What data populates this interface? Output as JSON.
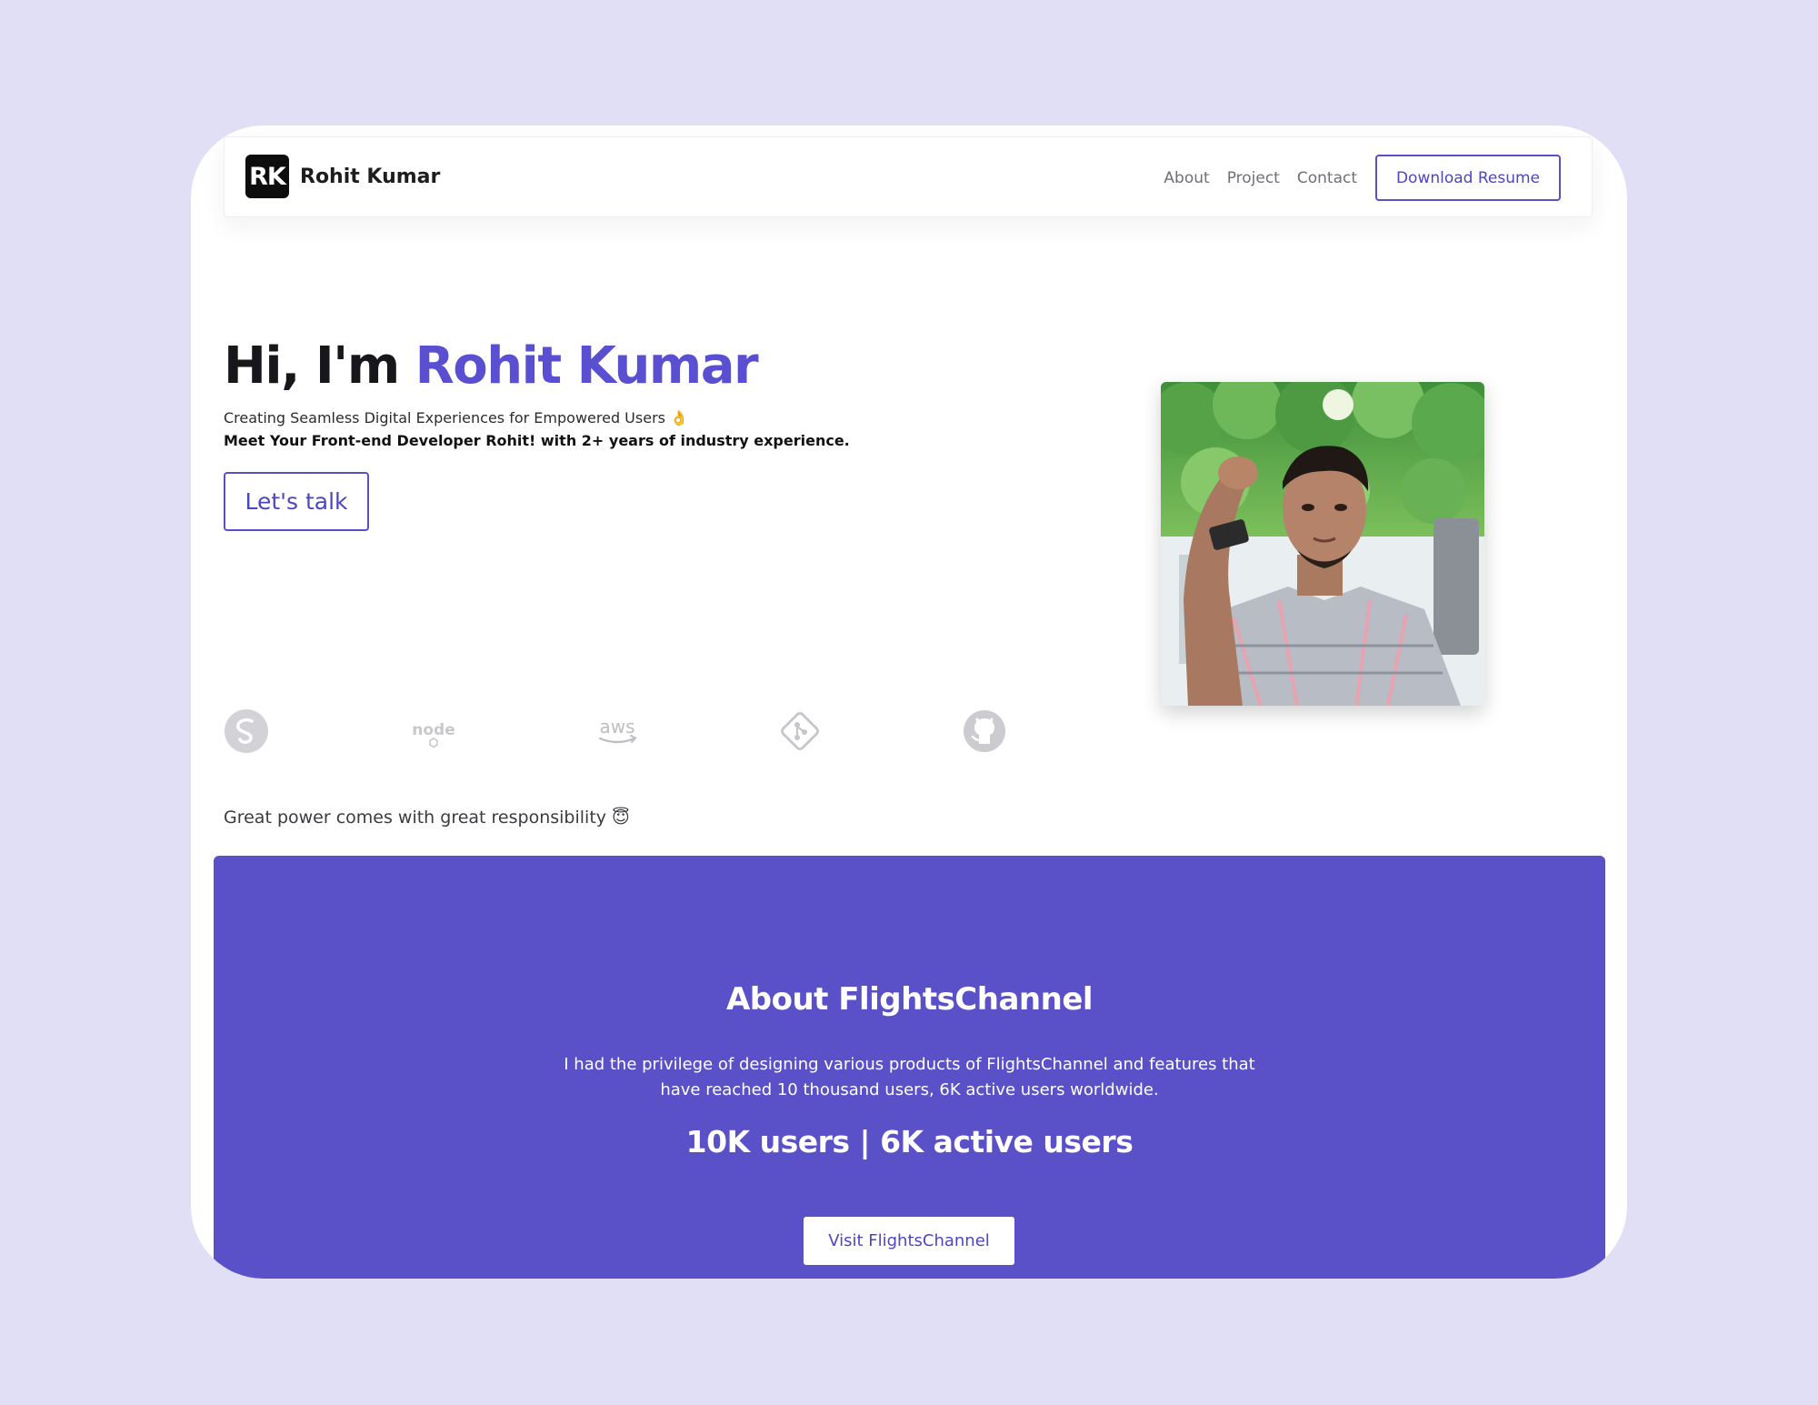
{
  "header": {
    "logo_initials": "RK",
    "brand_name": "Rohit Kumar",
    "nav": [
      {
        "label": "About"
      },
      {
        "label": "Project"
      },
      {
        "label": "Contact"
      }
    ],
    "resume_label": "Download Resume"
  },
  "hero": {
    "greeting": "Hi, I'm ",
    "name": "Rohit Kumar",
    "tagline": "Creating Seamless Digital Experiences for Empowered Users 👌",
    "intro": "Meet Your Front-end Developer Rohit! with 2+ years of industry experience.",
    "cta_label": "Let's talk",
    "tech_icons": [
      "sass-icon",
      "node-icon",
      "aws-icon",
      "git-icon",
      "github-icon"
    ],
    "tech_text": {
      "node": "node",
      "aws": "aws"
    },
    "motto": "Great power comes with great responsibility 😇"
  },
  "about": {
    "title": "About FlightsChannel",
    "description": "I had the privilege of designing various products of FlightsChannel and features that have reached 10 thousand users, 6K active users worldwide.",
    "stats": "10K users | 6K active users",
    "button_label": "Visit FlightsChannel"
  },
  "colors": {
    "page_bg": "#e1dff6",
    "accent": "#5a50c8",
    "text_dark": "#17171b"
  }
}
